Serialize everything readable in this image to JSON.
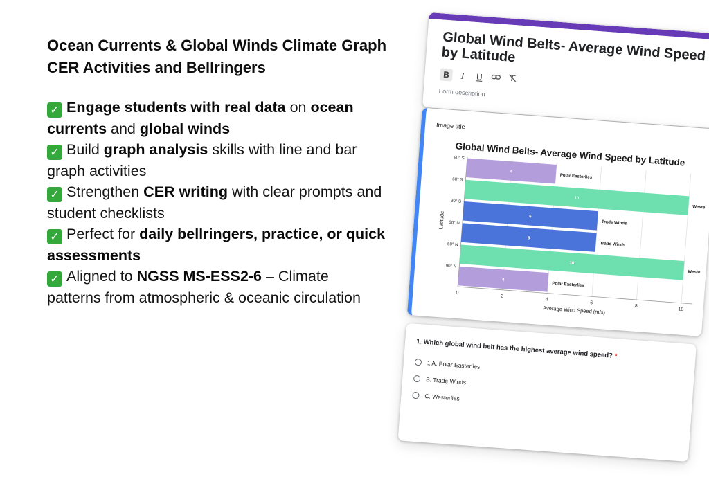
{
  "promo": {
    "title": "Ocean Currents & Global Winds Climate Graph CER Activities and Bellringers",
    "check_glyph": "✓",
    "bullets": [
      {
        "parts": [
          {
            "t": "Engage students with real data",
            "b": true
          },
          {
            "t": " on ",
            "b": false
          },
          {
            "t": "ocean currents",
            "b": true
          },
          {
            "t": " and ",
            "b": false
          },
          {
            "t": "global winds",
            "b": true
          }
        ]
      },
      {
        "parts": [
          {
            "t": "Build ",
            "b": false
          },
          {
            "t": "graph analysis",
            "b": true
          },
          {
            "t": " skills with line and bar graph activities",
            "b": false
          }
        ]
      },
      {
        "parts": [
          {
            "t": "Strengthen ",
            "b": false
          },
          {
            "t": "CER writing",
            "b": true
          },
          {
            "t": " with clear prompts and student checklists",
            "b": false
          }
        ]
      },
      {
        "parts": [
          {
            "t": "Perfect for ",
            "b": false
          },
          {
            "t": "daily bellringers, practice, or quick assessments",
            "b": true
          }
        ]
      },
      {
        "parts": [
          {
            "t": "Aligned to ",
            "b": false
          },
          {
            "t": "NGSS MS-ESS2-6",
            "b": true
          },
          {
            "t": " – Climate patterns from atmospheric & oceanic circulation",
            "b": false
          }
        ]
      }
    ]
  },
  "form": {
    "title": "Global Wind Belts- Average Wind Speed by Latitude",
    "toolbar": {
      "bold": "B",
      "italic": "I",
      "underline": "U",
      "link_icon": "link-icon",
      "clear_icon": "clear-format-icon"
    },
    "description_placeholder": "Form description",
    "image_title": "Image title",
    "question": {
      "title": "1. Which global wind belt has the highest average wind speed?",
      "required_mark": "*",
      "options": [
        "1 A. Polar Easterlies",
        "B. Trade Winds",
        "C. Westerlies"
      ]
    }
  },
  "chart_data": {
    "type": "bar",
    "orientation": "horizontal",
    "title": "Global Wind Belts- Average Wind Speed by Latitude",
    "xlabel": "Average Wind Speed (m/s)",
    "ylabel": "Latitude",
    "xlim": [
      0,
      10.5
    ],
    "xticks": [
      0,
      2,
      4,
      6,
      8,
      10
    ],
    "grid": true,
    "categories": [
      "90° S",
      "60° S",
      "30° S",
      "30° N",
      "60° N",
      "90° N"
    ],
    "bars": [
      {
        "label": "Polar Easterlies",
        "value": 4,
        "color": "#b39ddb"
      },
      {
        "label": "Westerlies",
        "value": 10,
        "color": "#6ee0b0"
      },
      {
        "label": "Trade Winds",
        "value": 6,
        "color": "#4a74d9"
      },
      {
        "label": "Trade Winds",
        "value": 6,
        "color": "#4a74d9"
      },
      {
        "label": "Westerlies",
        "value": 10,
        "color": "#6ee0b0"
      },
      {
        "label": "Polar Easterlies",
        "value": 4,
        "color": "#b39ddb"
      }
    ]
  },
  "colors": {
    "form_accent": "#673ab7",
    "active_card": "#4285f4",
    "check": "#35a83c"
  }
}
